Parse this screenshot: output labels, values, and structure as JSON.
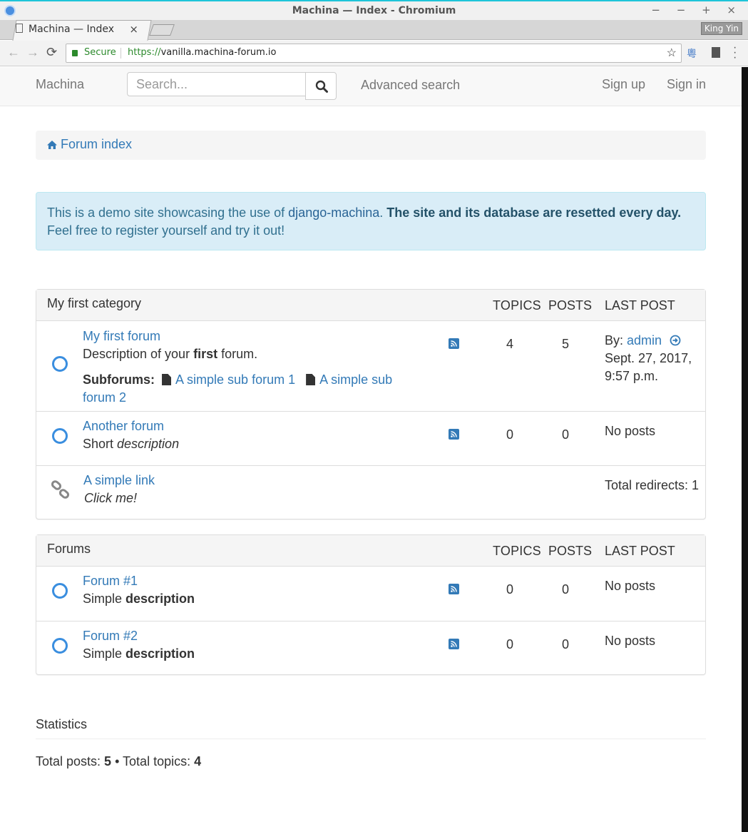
{
  "window": {
    "title": "Machina — Index - Chromium",
    "controls": "− − + ×"
  },
  "tab": {
    "title": "Machina — Index",
    "close": "×"
  },
  "profile": {
    "name": "King Yin"
  },
  "addressbar": {
    "secure_label": "Secure",
    "url_scheme": "https://",
    "url_host": "vanilla.machina-forum.io"
  },
  "navbar": {
    "brand": "Machina",
    "search_placeholder": "Search...",
    "advanced_search": "Advanced search",
    "sign_up": "Sign up",
    "sign_in": "Sign in"
  },
  "breadcrumb": {
    "label": "Forum index"
  },
  "alert": {
    "text_before": "This is a demo site showcasing the use of ",
    "link": "django-machina",
    "text_after": ". ",
    "bold": "The site and its database are resetted every day.",
    "line2": "Feel free to register yourself and try it out!"
  },
  "columns": {
    "topics": "TOPICS",
    "posts": "POSTS",
    "last_post": "LAST POST"
  },
  "category1": {
    "title": "My first category",
    "forum1": {
      "name": "My first forum",
      "desc_a": "Description of your ",
      "desc_b": "first",
      "desc_c": " forum.",
      "subforums_label": "Subforums:",
      "sub1": "A simple sub forum 1",
      "sub2": "A simple sub forum 2",
      "topics": "4",
      "posts": "5",
      "last_by": "By: ",
      "last_author": "admin",
      "last_date": "Sept. 27, 2017, 9:57 p.m."
    },
    "forum2": {
      "name": "Another forum",
      "desc_a": "Short ",
      "desc_b": "description",
      "topics": "0",
      "posts": "0",
      "last": "No posts"
    },
    "link": {
      "name": "A simple link",
      "desc": "Click me!",
      "redirects": "Total redirects: 1"
    }
  },
  "category2": {
    "title": "Forums",
    "forum1": {
      "name": "Forum #1",
      "desc_a": "Simple ",
      "desc_b": "description",
      "topics": "0",
      "posts": "0",
      "last": "No posts"
    },
    "forum2": {
      "name": "Forum #2",
      "desc_a": "Simple ",
      "desc_b": "description",
      "topics": "0",
      "posts": "0",
      "last": "No posts"
    }
  },
  "statistics": {
    "title": "Statistics",
    "posts_label": "Total posts: ",
    "posts_value": "5",
    "sep": " • ",
    "topics_label": "Total topics: ",
    "topics_value": "4"
  },
  "colors": {
    "link": "#337ab7",
    "alert_bg": "#d9edf7",
    "forum_icon": "#3a8edf",
    "secure": "#2c8a2c"
  }
}
